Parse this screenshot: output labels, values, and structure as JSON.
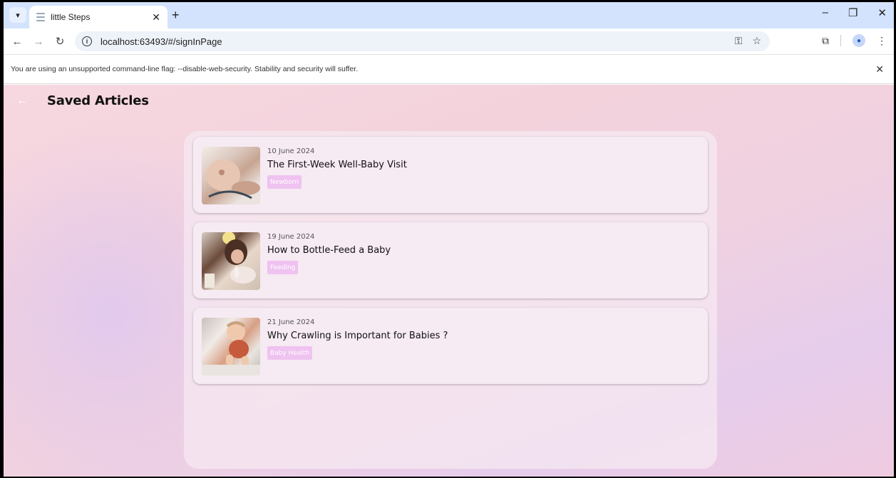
{
  "browser": {
    "tab_title": "little Steps",
    "url": "localhost:63493/#/signInPage",
    "infobar_text": "You are using an unsupported command-line flag: --disable-web-security. Stability and security will suffer."
  },
  "app": {
    "page_title": "Saved Articles",
    "articles": [
      {
        "date": "10 June 2024",
        "title": "The First-Week Well-Baby Visit",
        "tag": "Newborn"
      },
      {
        "date": "19 June 2024",
        "title": "How to Bottle-Feed a Baby",
        "tag": "Feeding"
      },
      {
        "date": "21 June 2024",
        "title": "Why Crawling is Important for Babies ?",
        "tag": "Baby Health"
      }
    ]
  },
  "colors": {
    "tag_bg": "#efc2f0",
    "tabstrip_bg": "#d3e3fd",
    "card_bg": "#f6eaf3"
  }
}
